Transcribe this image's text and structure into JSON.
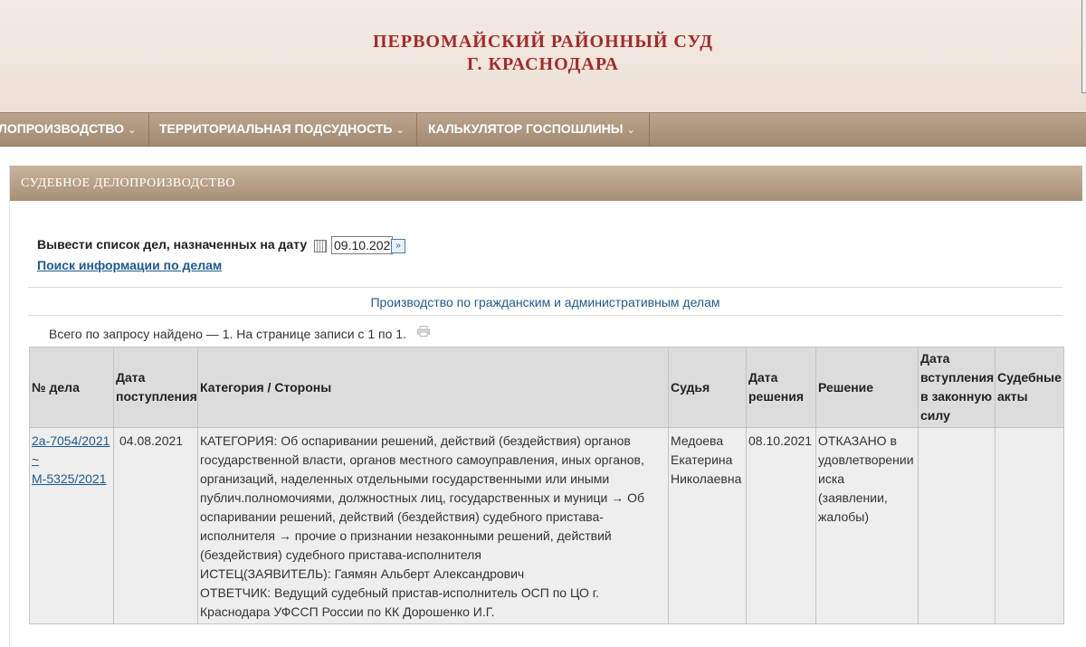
{
  "header": {
    "court_line1": "ПЕРВОМАЙСКИЙ РАЙОННЫЙ СУД",
    "court_line2": "Г. КРАСНОДАРА"
  },
  "nav": {
    "items": [
      {
        "label": "ЛОПРОИЗВОДСТВО"
      },
      {
        "label": "ТЕРРИТОРИАЛЬНАЯ ПОДСУДНОСТЬ"
      },
      {
        "label": "КАЛЬКУЛЯТОР ГОСПОШЛИНЫ"
      }
    ],
    "chevron": "⌄"
  },
  "section": {
    "title": "СУДЕБНОЕ ДЕЛОПРОИЗВОДСТВО"
  },
  "date_filter": {
    "label": "Вывести список дел, назначенных на дату",
    "value": "09.10.202",
    "go_symbol": "»"
  },
  "search_link": "Поиск информации по делам",
  "production_title": "Производство по гражданским и административным делам",
  "count_text": "Всего по запросу найдено — 1. На странице записи с 1 по 1.",
  "table": {
    "headers": {
      "case_no": "№ дела",
      "received": "Дата поступления",
      "category": "Категория / Стороны",
      "judge": "Судья",
      "decision_date": "Дата решения",
      "decision": "Решение",
      "effective": "Дата вступления в законную силу",
      "acts": "Судебные акты"
    },
    "rows": [
      {
        "case_no_line1": "2а-7054/2021",
        "case_no_line2": "~",
        "case_no_line3": "М-5325/2021",
        "received": "04.08.2021",
        "category": "КАТЕГОРИЯ: Об оспаривании решений, действий (бездействия) органов государственной власти, органов местного самоуправления, иных органов, организаций, наделенных отдельными государственными или иными публич.полномочиями, должностных лиц, государственных и муници → Об оспаривании решений, действий (бездействия) судебного пристава-исполнителя → прочие о признании незаконными решений, действий (бездействия) судебного пристава-исполнителя",
        "plaintiff": "ИСТЕЦ(ЗАЯВИТЕЛЬ): Гаямян Альберт Александрович",
        "defendant": "ОТВЕТЧИК: Ведущий судебный пристав-исполнитель ОСП по ЦО г. Краснодара УФССП России по КК Дорошенко И.Г.",
        "judge": "Медоева Екатерина Николаевна",
        "decision_date": "08.10.2021",
        "decision": "ОТКАЗАНО в удовлетворении иска (заявлении, жалобы)",
        "effective": "",
        "acts": ""
      }
    ]
  }
}
